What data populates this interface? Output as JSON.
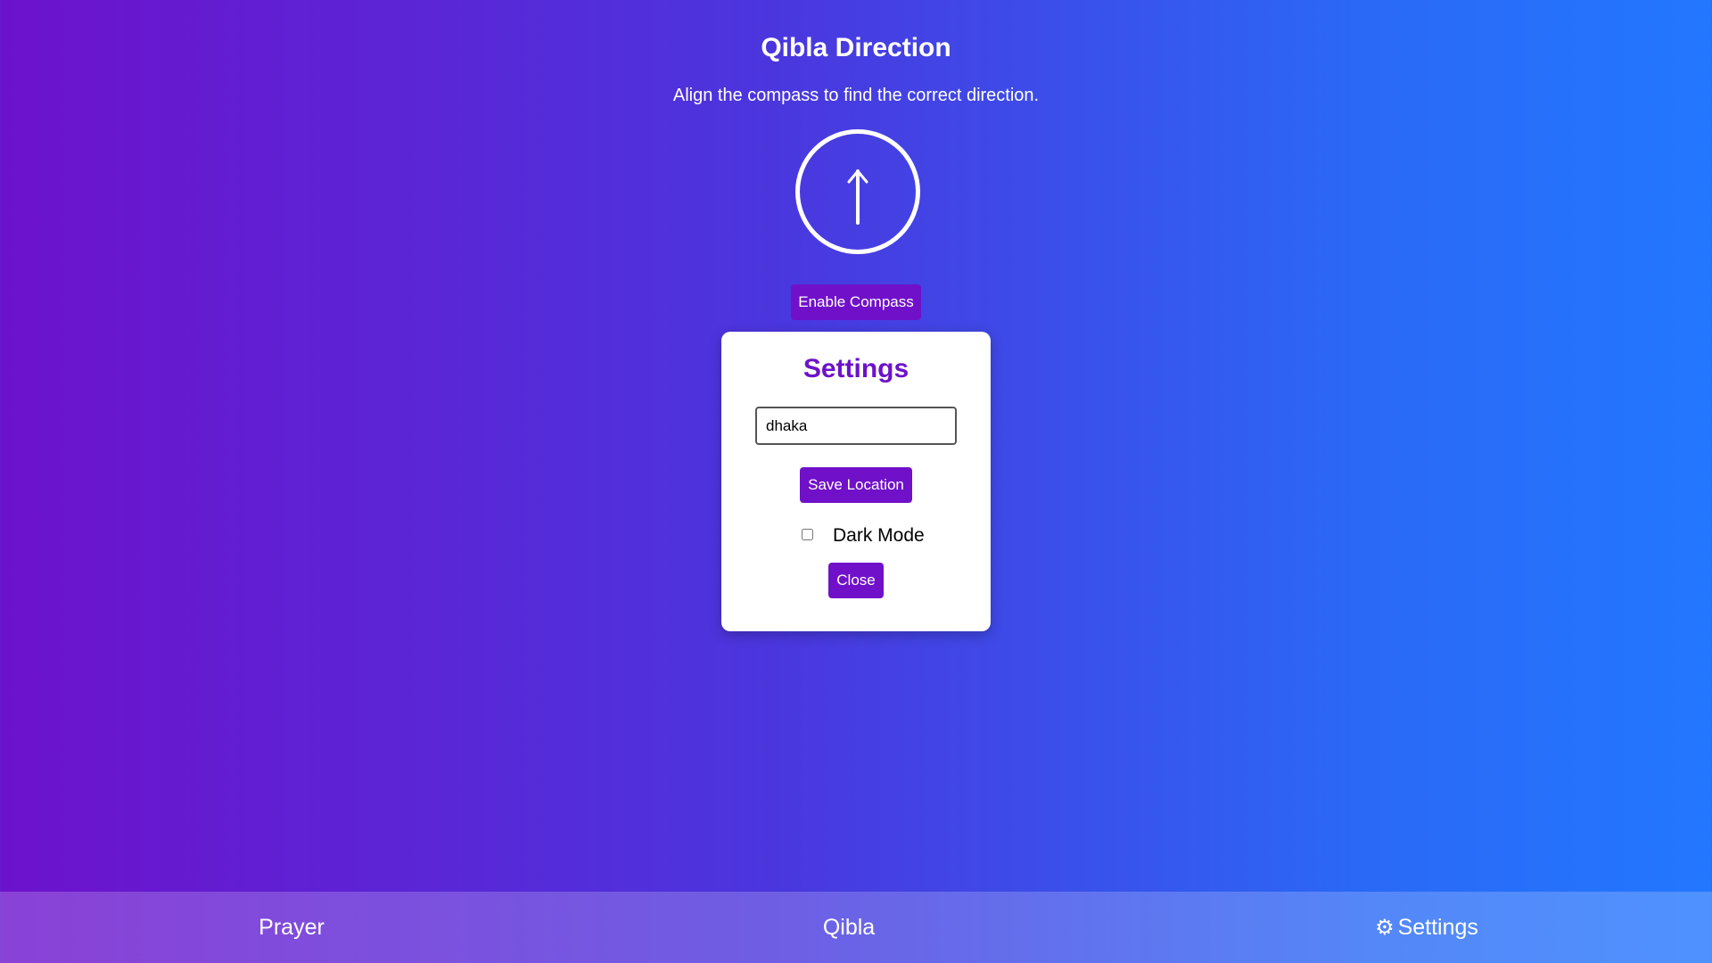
{
  "header": {
    "title": "Qibla Direction",
    "subtitle": "Align the compass to find the correct direction."
  },
  "compass": {
    "arrow_icon": "arrow-up-icon",
    "enable_button_label": "Enable Compass"
  },
  "settings": {
    "title": "Settings",
    "location_value": "dhaka",
    "save_button_label": "Save Location",
    "dark_mode_label": "Dark Mode",
    "dark_mode_checked": false,
    "close_button_label": "Close"
  },
  "nav": {
    "items": [
      {
        "label": "Prayer",
        "icon": ""
      },
      {
        "label": "Qibla",
        "icon": ""
      },
      {
        "label": "Settings",
        "icon": "gear-icon"
      }
    ]
  },
  "colors": {
    "accent": "#7011c9",
    "gradient_start": "#6d12cc",
    "gradient_end": "#2377ff",
    "card_bg": "#ffffff"
  }
}
